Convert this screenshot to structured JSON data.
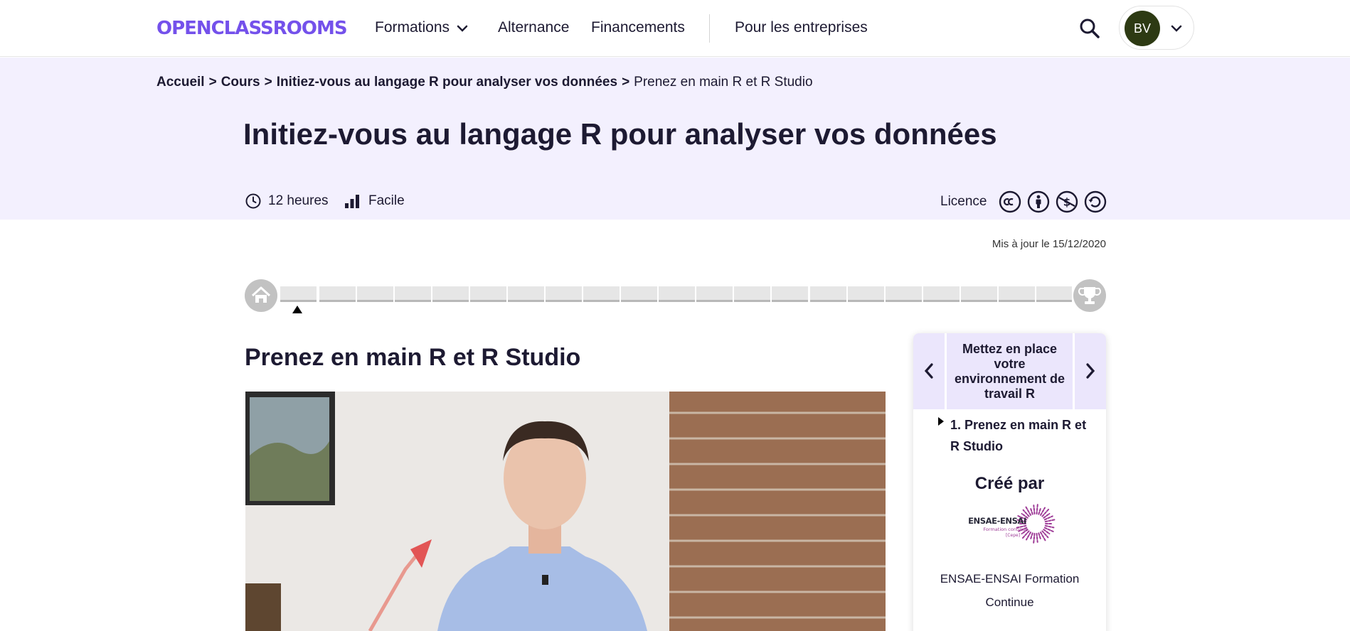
{
  "header": {
    "logo_text": "OPENCLASSROOMS",
    "nav": [
      {
        "label": "Formations"
      },
      {
        "label": "Alternance"
      },
      {
        "label": "Financements"
      },
      {
        "label": "Pour les entreprises"
      }
    ],
    "account": {
      "initials": "BV",
      "avatar_color": "#2d3a13"
    },
    "brand_color": "#7451eb"
  },
  "breadcrumb": {
    "items": [
      "Accueil",
      "Cours",
      "Initiez-vous au langage R pour analyser vos données"
    ],
    "separator": ">",
    "current": "Prenez en main R et R Studio"
  },
  "course": {
    "title": "Initiez-vous au langage R pour analyser vos données",
    "duration": "12 heures",
    "level": "Facile",
    "licence_label": "Licence",
    "licence_icons": [
      "cc-icon",
      "by-attribution-icon",
      "nc-noncommercial-icon",
      "sa-sharealike-icon"
    ],
    "updated": "Mis à jour le 15/12/2020"
  },
  "progress": {
    "groups": [
      1,
      7,
      6,
      7
    ],
    "current_segment": 1
  },
  "chapter": {
    "title": "Prenez en main R et R Studio"
  },
  "sidebar": {
    "part_title": "Mettez en place votre environnement de travail R",
    "lesson": "1. Prenez en main R et R Studio",
    "created_by_label": "Créé par",
    "logo_text": {
      "name": "ENSAE-ENSAI",
      "sub": "Formation continue",
      "tag": "[Cepe]"
    },
    "creator": "ENSAE-ENSAI Formation Continue"
  }
}
